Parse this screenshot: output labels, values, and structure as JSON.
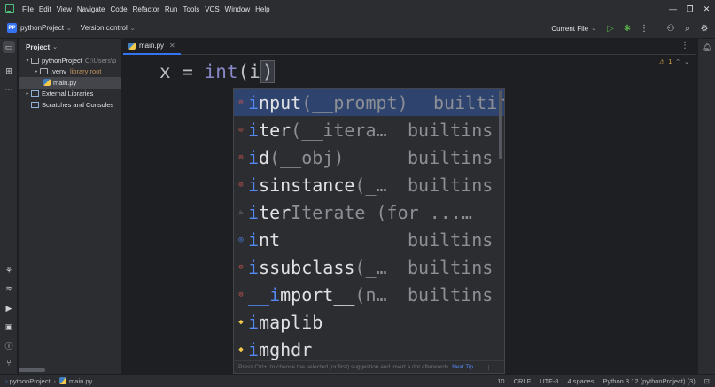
{
  "menu": [
    "File",
    "Edit",
    "View",
    "Navigate",
    "Code",
    "Refactor",
    "Run",
    "Tools",
    "VCS",
    "Window",
    "Help"
  ],
  "window_controls": {
    "minimize": "—",
    "restore": "❐",
    "close": "✕"
  },
  "toolbar": {
    "project_badge": "PP",
    "project_name": "pythonProject",
    "vcs_label": "Version control",
    "run_config": "Current File"
  },
  "project_panel": {
    "title": "Project",
    "root_name": "pythonProject",
    "root_path": "C:\\Users\\p",
    "venv_name": ".venv",
    "venv_note": "library root",
    "main_file": "main.py",
    "external_libraries": "External Libraries",
    "scratches": "Scratches and Consoles"
  },
  "editor": {
    "tab_name": "main.py",
    "code_prefix": "x = ",
    "code_fn": "int",
    "code_open": "(",
    "code_typed": "i",
    "code_close": ")",
    "warning_count": "1"
  },
  "completion": {
    "items": [
      {
        "icon": "function-icon",
        "match": "i",
        "rest": "nput",
        "tail": "(__prompt)",
        "source": "builtin"
      },
      {
        "icon": "function-icon",
        "match": "i",
        "rest": "ter",
        "tail": "(__itera…",
        "source": "builtins"
      },
      {
        "icon": "function-icon",
        "match": "i",
        "rest": "d",
        "tail": "(__obj)",
        "source": "builtins"
      },
      {
        "icon": "function-icon",
        "match": "i",
        "rest": "sinstance",
        "tail": "(_…",
        "source": "builtins"
      },
      {
        "icon": "live-template-icon",
        "match": "i",
        "rest": "ter",
        "tail": " Iterate (for ...…",
        "source": ""
      },
      {
        "icon": "class-icon",
        "match": "i",
        "rest": "nt",
        "tail": "",
        "source": "builtins"
      },
      {
        "icon": "function-icon",
        "match": "i",
        "rest": "ssubclass",
        "tail": "(_…",
        "source": "builtins"
      },
      {
        "icon": "function-icon",
        "match": "__i",
        "rest": "mport__",
        "tail": "(n…",
        "source": "builtins"
      },
      {
        "icon": "module-icon",
        "match": "i",
        "rest": "maplib",
        "tail": "",
        "source": ""
      },
      {
        "icon": "module-icon",
        "match": "i",
        "rest": "mghdr",
        "tail": "",
        "source": ""
      }
    ],
    "hint_text": "Press Ctrl+. to choose the selected (or first) suggestion and insert a dot afterwards",
    "hint_link": "Next Tip"
  },
  "status": {
    "project": "pythonProject",
    "file": "main.py",
    "position": "10",
    "line_sep": "CRLF",
    "encoding": "UTF-8",
    "indent": "4 spaces",
    "interpreter": "Python 3.12 (pythonProject) (3)"
  }
}
